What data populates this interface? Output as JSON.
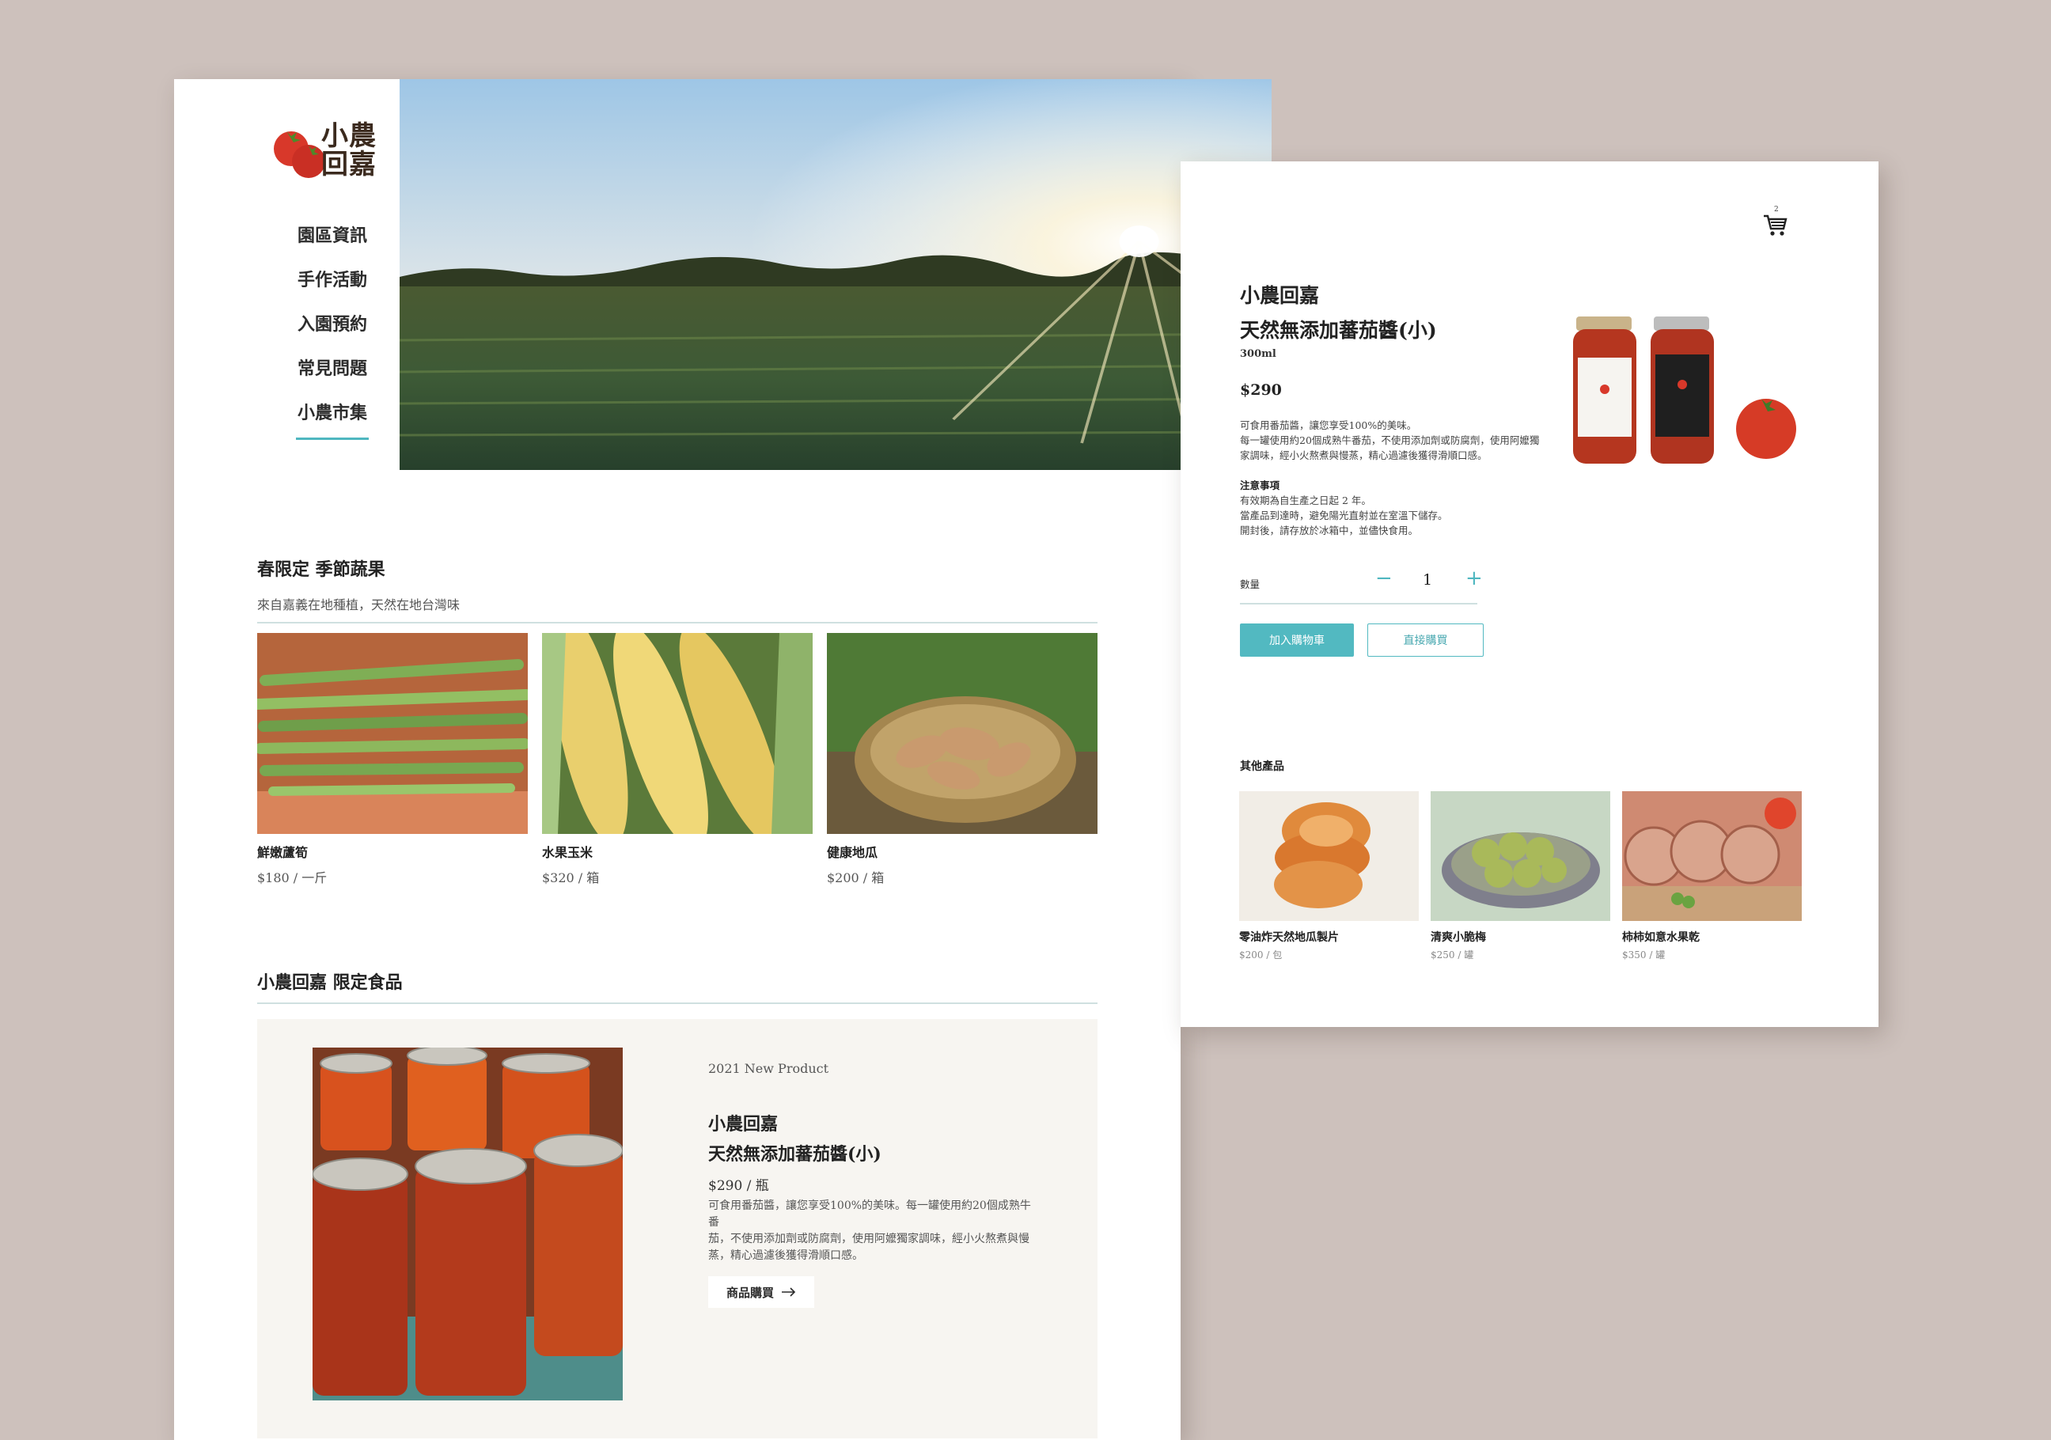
{
  "brand": {
    "logo_line1": "小農",
    "logo_line2": "回嘉"
  },
  "nav": {
    "items": [
      {
        "label": "園區資訊"
      },
      {
        "label": "手作活動"
      },
      {
        "label": "入園預約"
      },
      {
        "label": "常見問題"
      },
      {
        "label": "小農市集",
        "active": true
      }
    ]
  },
  "seasonal": {
    "title": "春限定 季節蔬果",
    "subtitle": "來自嘉義在地種植，天然在地台灣味",
    "items": [
      {
        "name": "鮮嫩蘆筍",
        "price": "$180 / 一斤"
      },
      {
        "name": "水果玉米",
        "price": "$320 / 箱"
      },
      {
        "name": "健康地瓜",
        "price": "$200 / 箱"
      }
    ]
  },
  "limited": {
    "title": "小農回嘉 限定食品",
    "tag": "2021 New Product",
    "brand": "小農回嘉",
    "name": "天然無添加蕃茄醬(小)",
    "price": "$290 / 瓶",
    "desc_lines": [
      "可食用番茄醬，讓您享受100%的美味。每一罐使用約20個成熟牛番",
      "茄，不使用添加劑或防腐劑，使用阿嬤獨家調味，經小火熬煮與慢",
      "蒸，精心過濾後獲得滑順口感。"
    ],
    "buy_label": "商品購買"
  },
  "detail": {
    "cart_count": "2",
    "brand": "小農回嘉",
    "name": "天然無添加蕃茄醬(小)",
    "volume": "300ml",
    "price": "$290",
    "desc_lines": [
      "可食用番茄醬，讓您享受100%的美味。",
      "每一罐使用約20個成熟牛番茄，不使用添加劑或防腐劑，使用阿嬤獨",
      "家調味，經小火熬煮與慢蒸，精心過濾後獲得滑順口感。"
    ],
    "note_title": "注意事項",
    "note_lines": [
      "有效期為自生產之日起 2 年。",
      "當產品到達時，避免陽光直射並在室溫下儲存。",
      "開封後，請存放於冰箱中，並儘快食用。"
    ],
    "qty_label": "數量",
    "qty_value": "1",
    "add_to_cart": "加入購物車",
    "buy_now": "直接購買",
    "others_title": "其他產品",
    "others": [
      {
        "name": "零油炸天然地瓜製片",
        "price": "$200 / 包"
      },
      {
        "name": "清爽小脆梅",
        "price": "$250 / 罐"
      },
      {
        "name": "柿柿如意水果乾",
        "price": "$350 / 罐"
      }
    ]
  },
  "colors": {
    "accent": "#52b9c1",
    "background": "#cdc1bc",
    "logo_tomato": "#d8382a"
  }
}
